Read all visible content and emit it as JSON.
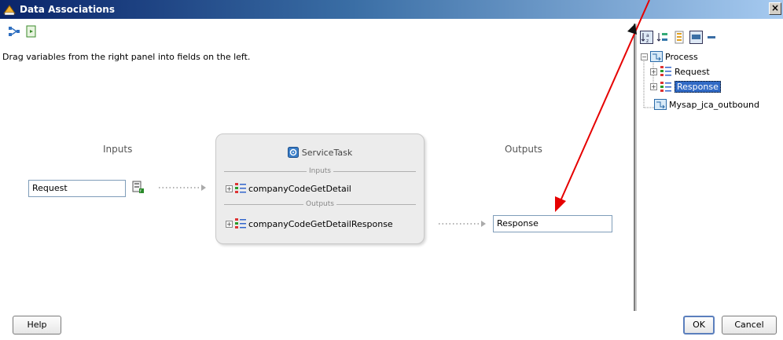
{
  "window": {
    "title": "Data Associations",
    "close_glyph": "×"
  },
  "hint": "Drag variables from the right panel into fields on the left.",
  "inputs": {
    "label": "Inputs",
    "field_value": "Request"
  },
  "outputs": {
    "label": "Outputs",
    "field_value": "Response"
  },
  "service_task": {
    "title": "ServiceTask",
    "inputs_sep": "Inputs",
    "input_item": "companyCodeGetDetail",
    "outputs_sep": "Outputs",
    "output_item": "companyCodeGetDetailResponse"
  },
  "tree": {
    "root": "Process",
    "children": [
      "Request",
      "Response"
    ],
    "sibling": "Mysap_jca_outbound"
  },
  "buttons": {
    "help": "Help",
    "ok": "OK",
    "cancel": "Cancel"
  },
  "colors": {
    "annotation_arrow": "#e60000",
    "selection": "#316ac5",
    "title_bar": "#0a246a"
  }
}
